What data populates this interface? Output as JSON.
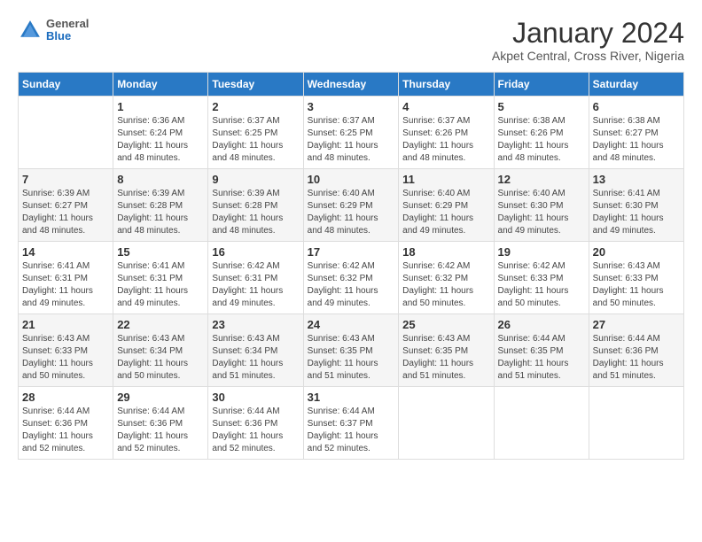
{
  "logo": {
    "general": "General",
    "blue": "Blue"
  },
  "title": "January 2024",
  "subtitle": "Akpet Central, Cross River, Nigeria",
  "days_of_week": [
    "Sunday",
    "Monday",
    "Tuesday",
    "Wednesday",
    "Thursday",
    "Friday",
    "Saturday"
  ],
  "weeks": [
    [
      {
        "day": "",
        "sunrise": "",
        "sunset": "",
        "daylight": ""
      },
      {
        "day": "1",
        "sunrise": "Sunrise: 6:36 AM",
        "sunset": "Sunset: 6:24 PM",
        "daylight": "Daylight: 11 hours and 48 minutes."
      },
      {
        "day": "2",
        "sunrise": "Sunrise: 6:37 AM",
        "sunset": "Sunset: 6:25 PM",
        "daylight": "Daylight: 11 hours and 48 minutes."
      },
      {
        "day": "3",
        "sunrise": "Sunrise: 6:37 AM",
        "sunset": "Sunset: 6:25 PM",
        "daylight": "Daylight: 11 hours and 48 minutes."
      },
      {
        "day": "4",
        "sunrise": "Sunrise: 6:37 AM",
        "sunset": "Sunset: 6:26 PM",
        "daylight": "Daylight: 11 hours and 48 minutes."
      },
      {
        "day": "5",
        "sunrise": "Sunrise: 6:38 AM",
        "sunset": "Sunset: 6:26 PM",
        "daylight": "Daylight: 11 hours and 48 minutes."
      },
      {
        "day": "6",
        "sunrise": "Sunrise: 6:38 AM",
        "sunset": "Sunset: 6:27 PM",
        "daylight": "Daylight: 11 hours and 48 minutes."
      }
    ],
    [
      {
        "day": "7",
        "sunrise": "Sunrise: 6:39 AM",
        "sunset": "Sunset: 6:27 PM",
        "daylight": "Daylight: 11 hours and 48 minutes."
      },
      {
        "day": "8",
        "sunrise": "Sunrise: 6:39 AM",
        "sunset": "Sunset: 6:28 PM",
        "daylight": "Daylight: 11 hours and 48 minutes."
      },
      {
        "day": "9",
        "sunrise": "Sunrise: 6:39 AM",
        "sunset": "Sunset: 6:28 PM",
        "daylight": "Daylight: 11 hours and 48 minutes."
      },
      {
        "day": "10",
        "sunrise": "Sunrise: 6:40 AM",
        "sunset": "Sunset: 6:29 PM",
        "daylight": "Daylight: 11 hours and 48 minutes."
      },
      {
        "day": "11",
        "sunrise": "Sunrise: 6:40 AM",
        "sunset": "Sunset: 6:29 PM",
        "daylight": "Daylight: 11 hours and 49 minutes."
      },
      {
        "day": "12",
        "sunrise": "Sunrise: 6:40 AM",
        "sunset": "Sunset: 6:30 PM",
        "daylight": "Daylight: 11 hours and 49 minutes."
      },
      {
        "day": "13",
        "sunrise": "Sunrise: 6:41 AM",
        "sunset": "Sunset: 6:30 PM",
        "daylight": "Daylight: 11 hours and 49 minutes."
      }
    ],
    [
      {
        "day": "14",
        "sunrise": "Sunrise: 6:41 AM",
        "sunset": "Sunset: 6:31 PM",
        "daylight": "Daylight: 11 hours and 49 minutes."
      },
      {
        "day": "15",
        "sunrise": "Sunrise: 6:41 AM",
        "sunset": "Sunset: 6:31 PM",
        "daylight": "Daylight: 11 hours and 49 minutes."
      },
      {
        "day": "16",
        "sunrise": "Sunrise: 6:42 AM",
        "sunset": "Sunset: 6:31 PM",
        "daylight": "Daylight: 11 hours and 49 minutes."
      },
      {
        "day": "17",
        "sunrise": "Sunrise: 6:42 AM",
        "sunset": "Sunset: 6:32 PM",
        "daylight": "Daylight: 11 hours and 49 minutes."
      },
      {
        "day": "18",
        "sunrise": "Sunrise: 6:42 AM",
        "sunset": "Sunset: 6:32 PM",
        "daylight": "Daylight: 11 hours and 50 minutes."
      },
      {
        "day": "19",
        "sunrise": "Sunrise: 6:42 AM",
        "sunset": "Sunset: 6:33 PM",
        "daylight": "Daylight: 11 hours and 50 minutes."
      },
      {
        "day": "20",
        "sunrise": "Sunrise: 6:43 AM",
        "sunset": "Sunset: 6:33 PM",
        "daylight": "Daylight: 11 hours and 50 minutes."
      }
    ],
    [
      {
        "day": "21",
        "sunrise": "Sunrise: 6:43 AM",
        "sunset": "Sunset: 6:33 PM",
        "daylight": "Daylight: 11 hours and 50 minutes."
      },
      {
        "day": "22",
        "sunrise": "Sunrise: 6:43 AM",
        "sunset": "Sunset: 6:34 PM",
        "daylight": "Daylight: 11 hours and 50 minutes."
      },
      {
        "day": "23",
        "sunrise": "Sunrise: 6:43 AM",
        "sunset": "Sunset: 6:34 PM",
        "daylight": "Daylight: 11 hours and 51 minutes."
      },
      {
        "day": "24",
        "sunrise": "Sunrise: 6:43 AM",
        "sunset": "Sunset: 6:35 PM",
        "daylight": "Daylight: 11 hours and 51 minutes."
      },
      {
        "day": "25",
        "sunrise": "Sunrise: 6:43 AM",
        "sunset": "Sunset: 6:35 PM",
        "daylight": "Daylight: 11 hours and 51 minutes."
      },
      {
        "day": "26",
        "sunrise": "Sunrise: 6:44 AM",
        "sunset": "Sunset: 6:35 PM",
        "daylight": "Daylight: 11 hours and 51 minutes."
      },
      {
        "day": "27",
        "sunrise": "Sunrise: 6:44 AM",
        "sunset": "Sunset: 6:36 PM",
        "daylight": "Daylight: 11 hours and 51 minutes."
      }
    ],
    [
      {
        "day": "28",
        "sunrise": "Sunrise: 6:44 AM",
        "sunset": "Sunset: 6:36 PM",
        "daylight": "Daylight: 11 hours and 52 minutes."
      },
      {
        "day": "29",
        "sunrise": "Sunrise: 6:44 AM",
        "sunset": "Sunset: 6:36 PM",
        "daylight": "Daylight: 11 hours and 52 minutes."
      },
      {
        "day": "30",
        "sunrise": "Sunrise: 6:44 AM",
        "sunset": "Sunset: 6:36 PM",
        "daylight": "Daylight: 11 hours and 52 minutes."
      },
      {
        "day": "31",
        "sunrise": "Sunrise: 6:44 AM",
        "sunset": "Sunset: 6:37 PM",
        "daylight": "Daylight: 11 hours and 52 minutes."
      },
      {
        "day": "",
        "sunrise": "",
        "sunset": "",
        "daylight": ""
      },
      {
        "day": "",
        "sunrise": "",
        "sunset": "",
        "daylight": ""
      },
      {
        "day": "",
        "sunrise": "",
        "sunset": "",
        "daylight": ""
      }
    ]
  ]
}
